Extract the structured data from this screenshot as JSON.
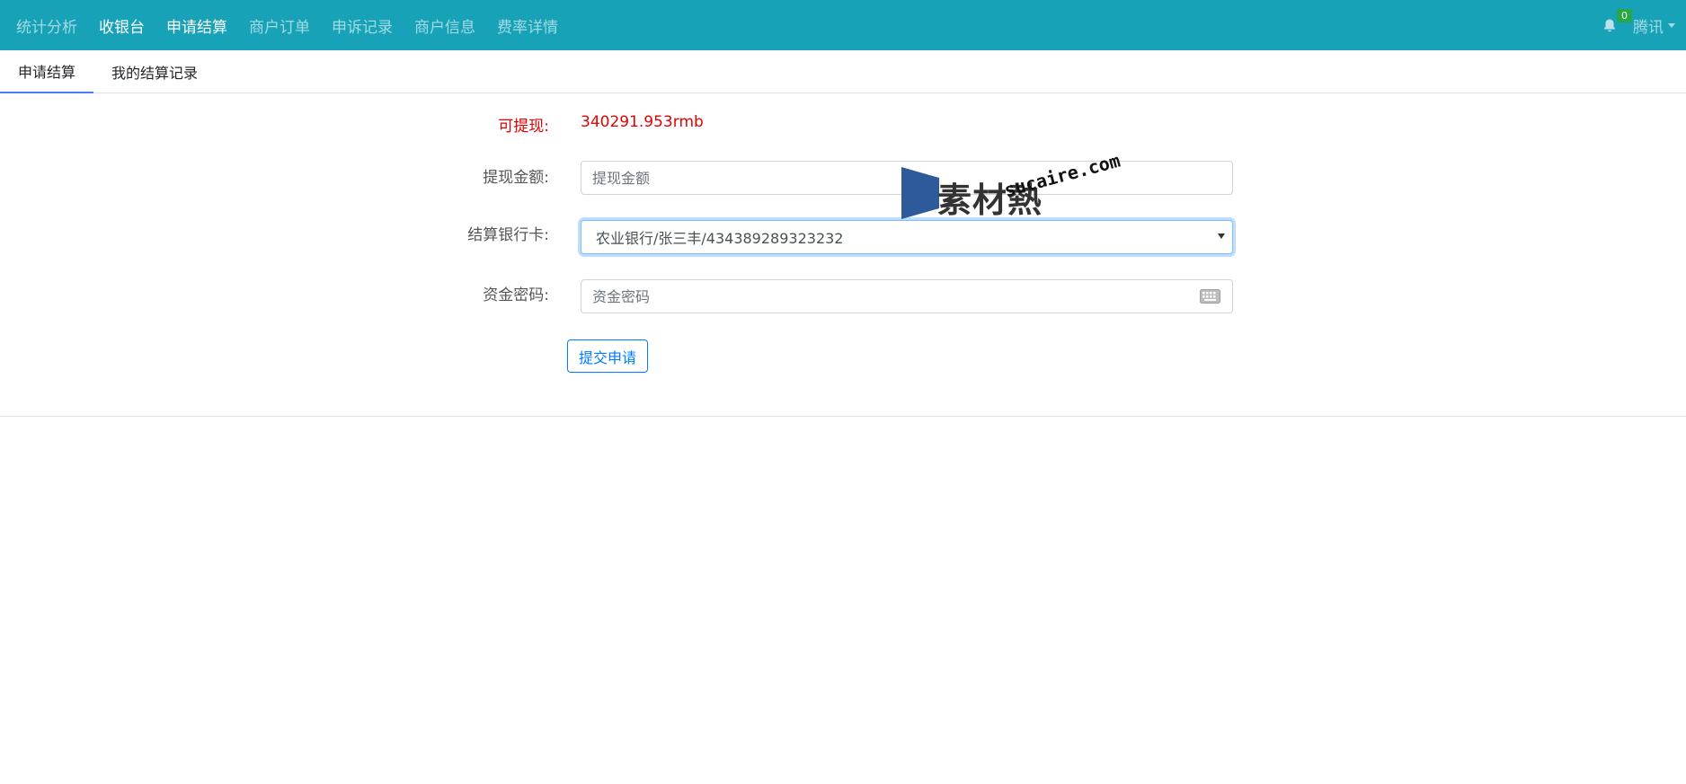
{
  "nav": {
    "items": [
      {
        "label": "统计分析",
        "active": false
      },
      {
        "label": "收银台",
        "active": true
      },
      {
        "label": "申请结算",
        "active": true
      },
      {
        "label": "商户订单",
        "active": false
      },
      {
        "label": "申诉记录",
        "active": false
      },
      {
        "label": "商户信息",
        "active": false
      },
      {
        "label": "费率详情",
        "active": false
      }
    ],
    "notification_count": "0",
    "user_label": "腾讯"
  },
  "tabs": [
    {
      "label": "申请结算",
      "active": true
    },
    {
      "label": "我的结算记录",
      "active": false
    }
  ],
  "form": {
    "available_label": "可提现:",
    "available_value": "340291.953rmb",
    "amount_label": "提现金额:",
    "amount_placeholder": "提现金额",
    "bank_label": "结算银行卡:",
    "bank_selected": "农业银行/张三丰/434389289323232",
    "password_label": "资金密码:",
    "password_placeholder": "资金密码",
    "submit_label": "提交申请"
  },
  "watermark": {
    "text": "素材熱",
    "url": "sucaire.com"
  },
  "colors": {
    "navbar": "#17a2b8",
    "highlight_red": "#e60000",
    "primary": "#007bff",
    "badge": "#28a745"
  }
}
